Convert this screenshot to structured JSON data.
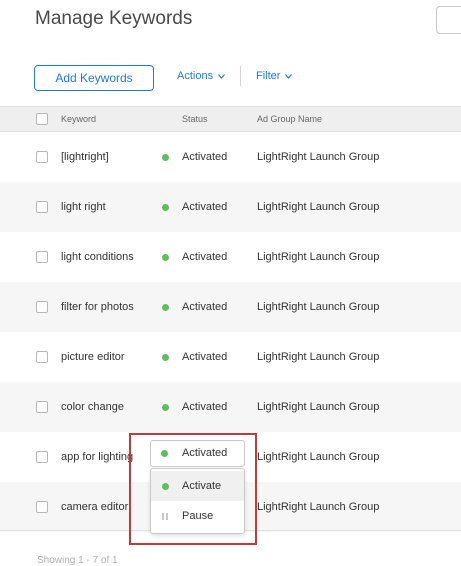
{
  "page": {
    "title": "Manage Keywords"
  },
  "toolbar": {
    "add_label": "Add Keywords",
    "actions_label": "Actions",
    "filter_label": "Filter"
  },
  "table": {
    "columns": {
      "keyword": "Keyword",
      "status": "Status",
      "ad_group": "Ad Group Name"
    },
    "rows": [
      {
        "keyword": "[lightright]",
        "status": "Activated",
        "ad_group": "LightRight Launch Group"
      },
      {
        "keyword": "light right",
        "status": "Activated",
        "ad_group": "LightRight Launch Group"
      },
      {
        "keyword": "light conditions",
        "status": "Activated",
        "ad_group": "LightRight Launch Group"
      },
      {
        "keyword": "filter for photos",
        "status": "Activated",
        "ad_group": "LightRight Launch Group"
      },
      {
        "keyword": "picture editor",
        "status": "Activated",
        "ad_group": "LightRight Launch Group"
      },
      {
        "keyword": "color change",
        "status": "Activated",
        "ad_group": "LightRight Launch Group"
      },
      {
        "keyword": "app for lighting",
        "status": "Activated",
        "ad_group": "LightRight Launch Group"
      },
      {
        "keyword": "camera editor",
        "status": "",
        "ad_group": "LightRight Launch Group"
      }
    ]
  },
  "status_dropdown": {
    "selected": "Activated",
    "options": [
      {
        "label": "Activate",
        "icon": "green-dot-icon"
      },
      {
        "label": "Pause",
        "icon": "pause-icon"
      }
    ]
  },
  "footer": {
    "showing": "Showing 1 - 7 of 1"
  },
  "colors": {
    "accent": "#1f7ae0",
    "status_active": "#5cbf5c",
    "highlight": "#c43a3a"
  }
}
